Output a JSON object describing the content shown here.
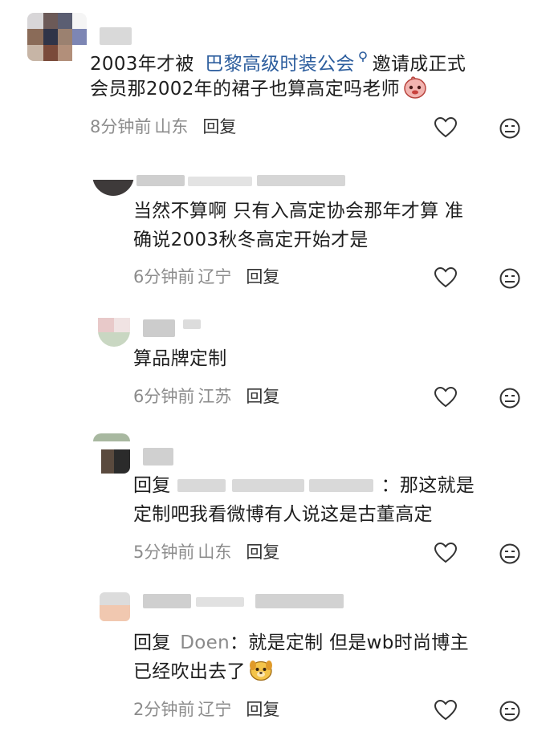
{
  "comments": [
    {
      "text_lines": [
        "2003年才被",
        "巴黎高级时装公会",
        "邀请成正式",
        "会员那2002年的裙子也算高定吗老师"
      ],
      "time": "8分钟前",
      "location": "山东",
      "reply_label": "回复",
      "search_icon": "search-icon",
      "emoji": "peach-face-emoji"
    },
    {
      "text_lines": [
        "当然不算啊 只有入高定协会那年才算 准",
        "确说2003秋冬高定开始才是"
      ],
      "time": "6分钟前",
      "location": "辽宁",
      "reply_label": "回复"
    },
    {
      "text_lines": [
        "算品牌定制"
      ],
      "time": "6分钟前",
      "location": "江苏",
      "reply_label": "回复"
    },
    {
      "reply_prefix": "回复",
      "text_lines": [
        "：那这就是",
        "定制吧我看微博有人说这是古董高定"
      ],
      "time": "5分钟前",
      "location": "山东",
      "reply_label": "回复"
    },
    {
      "reply_prefix": "回复",
      "reply_target": "Doen",
      "text_lines": [
        "：就是定制 但是wb时尚博主",
        "已经吹出去了"
      ],
      "time": "2分钟前",
      "location": "辽宁",
      "reply_label": "回复",
      "emoji": "dog-face-emoji"
    }
  ],
  "icons": {
    "like": "heart-outline-icon",
    "dislike": "neutral-face-icon"
  },
  "colors": {
    "link": "#2d5e9e",
    "meta": "#8c8c8c",
    "text": "#1e1e1e"
  }
}
